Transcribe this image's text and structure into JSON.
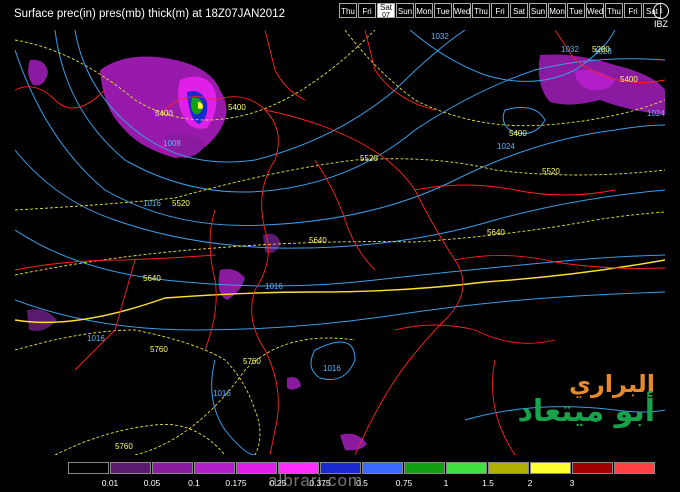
{
  "header": {
    "title": "Surface prec(in) pres(mb) thick(m) at 18Z07JAN2012",
    "days": [
      {
        "label": "Thu"
      },
      {
        "label": "Fri"
      },
      {
        "label": "Sat",
        "sub": "07",
        "selected": true
      },
      {
        "label": "Sun"
      },
      {
        "label": "Mon"
      },
      {
        "label": "Tue"
      },
      {
        "label": "Wed"
      },
      {
        "label": "Thu"
      },
      {
        "label": "Fri"
      },
      {
        "label": "Sat"
      },
      {
        "label": "Sun"
      },
      {
        "label": "Mon"
      },
      {
        "label": "Tue"
      },
      {
        "label": "Wed"
      },
      {
        "label": "Thu"
      },
      {
        "label": "Fri"
      },
      {
        "label": "Sat"
      }
    ],
    "info_label": "i",
    "info_sub": "IBZ"
  },
  "map": {
    "pressure_labels": [
      {
        "text": "1032"
      },
      {
        "text": "1032"
      },
      {
        "text": "1028"
      },
      {
        "text": "1024"
      },
      {
        "text": "1024"
      },
      {
        "text": "1008"
      },
      {
        "text": "1016"
      },
      {
        "text": "1016"
      },
      {
        "text": "1016"
      },
      {
        "text": "1016"
      },
      {
        "text": "1016"
      }
    ],
    "thickness_labels": [
      {
        "text": "5400"
      },
      {
        "text": "5400"
      },
      {
        "text": "5400"
      },
      {
        "text": "5400"
      },
      {
        "text": "5280"
      },
      {
        "text": "5520"
      },
      {
        "text": "5520"
      },
      {
        "text": "5520"
      },
      {
        "text": "5640"
      },
      {
        "text": "5640"
      },
      {
        "text": "5640"
      },
      {
        "text": "5760"
      },
      {
        "text": "5760"
      },
      {
        "text": "5760"
      }
    ],
    "colors": {
      "pressure": "#5fb6ff",
      "thickness": "#ffff66",
      "borders": "#ff2020",
      "coast": "#ff2020"
    }
  },
  "watermark": {
    "line1": "البراري",
    "line2": "أبو ميتعاد",
    "url": "albrari.com"
  },
  "legend": {
    "colors": [
      "#000000",
      "#5a1a6e",
      "#8a1aa0",
      "#b21ec8",
      "#e020e8",
      "#ff30ff",
      "#1a2ad0",
      "#3a6aff",
      "#10a010",
      "#40e040",
      "#b0b000",
      "#ffff30",
      "#a00000",
      "#ff4040"
    ],
    "ticks": [
      "0.01",
      "0.05",
      "0.1",
      "0.175",
      "0.25",
      "0.375",
      "0.5",
      "0.75",
      "1",
      "1.5",
      "2",
      "3"
    ]
  }
}
